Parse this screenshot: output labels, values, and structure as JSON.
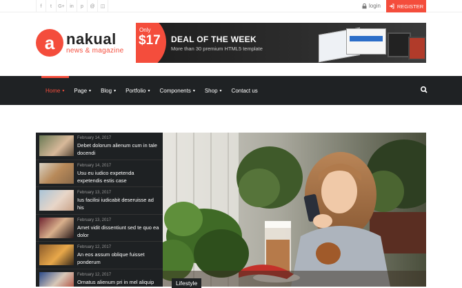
{
  "topbar": {
    "social_icons": [
      "facebook-icon",
      "twitter-icon",
      "google-plus-icon",
      "linkedin-icon",
      "pinterest-icon",
      "dribbble-icon",
      "instagram-icon"
    ],
    "social_glyphs": [
      "f",
      "t",
      "G+",
      "in",
      "p",
      "@",
      "◫"
    ],
    "login": "login",
    "register": "REGISTER"
  },
  "logo": {
    "letter": "a",
    "name": "nakual",
    "tagline": "news & magazine"
  },
  "ad": {
    "only": "Only",
    "price": "$17",
    "title": "DEAL OF THE WEEK",
    "subtitle": "More than 30 premium HTML5 template"
  },
  "nav": {
    "items": [
      {
        "label": "Home",
        "active": true,
        "caret": true
      },
      {
        "label": "Page",
        "caret": true
      },
      {
        "label": "Blog",
        "caret": true
      },
      {
        "label": "Portfolio",
        "caret": true
      },
      {
        "label": "Components",
        "caret": true
      },
      {
        "label": "Shop",
        "caret": true
      },
      {
        "label": "Contact us",
        "caret": false
      }
    ]
  },
  "sidebar": {
    "posts": [
      {
        "date": "February 14, 2017",
        "title": "Debet dolorum alienum cum in tale docendi"
      },
      {
        "date": "February 14, 2017",
        "title": "Usu eu iudico expetenda expetendis estis case"
      },
      {
        "date": "February 13, 2017",
        "title": "Ius facilisi iudicabit deseruisse ad his"
      },
      {
        "date": "February 13, 2017",
        "title": "Amet vidit dissentiunt sed te quo ea dolor"
      },
      {
        "date": "February 12, 2017",
        "title": "An eos assum oblique fuisset ponderum"
      },
      {
        "date": "February 12, 2017",
        "title": "Ornatus alienum pri in mel aliquip"
      }
    ]
  },
  "hero": {
    "category": "Lifestyle"
  },
  "colors": {
    "accent": "#f44d3c",
    "nav_bg": "#1f2224"
  }
}
